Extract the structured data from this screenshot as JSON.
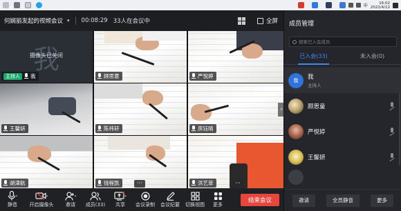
{
  "taskbar": {
    "clock_time": "16:02",
    "clock_date": "2022/4/12",
    "lang": "中"
  },
  "meeting": {
    "title": "何娴丽发起的视频会议",
    "timer": "00:08:29",
    "participant_count": "33人在会议中",
    "fullscreen_label": "全屏"
  },
  "tiles": [
    {
      "name": "我",
      "host_badge": "主持人",
      "camera_off_text": "摄像头已关闭",
      "avatar_char": "我"
    },
    {
      "name": "顾思意"
    },
    {
      "name": "严悦婷"
    },
    {
      "name": "王馨妍"
    },
    {
      "name": "陈祎轩"
    },
    {
      "name": "房钰晴"
    },
    {
      "name": "胡津航"
    },
    {
      "name": "钱程凯"
    },
    {
      "name": "洪艺菲"
    }
  ],
  "toolbar": {
    "mute": "静音",
    "camera": "开启摄像头",
    "invite": "邀请",
    "members": "成员(33)",
    "share": "共享",
    "record": "会议录制",
    "minutes": "会议纪要",
    "view": "切换视图",
    "more": "更多",
    "end": "结束会议"
  },
  "panel": {
    "title": "成员管理",
    "search_placeholder": "搜索已入会成员",
    "tab_joined": "已入会(33)",
    "tab_not_joined": "未入会(0)",
    "members": [
      {
        "name": "我",
        "role": "主持人",
        "avatar_text": "我"
      },
      {
        "name": "顾思童"
      },
      {
        "name": "严悦婷"
      },
      {
        "name": "王馨妍"
      }
    ],
    "footer": {
      "invite": "邀请",
      "mute_all": "全员静音",
      "more": "更多"
    }
  },
  "colors": {
    "end_button": "#e8453c",
    "accent_blue": "#3b8cf2",
    "host_green": "#1aa86a"
  }
}
